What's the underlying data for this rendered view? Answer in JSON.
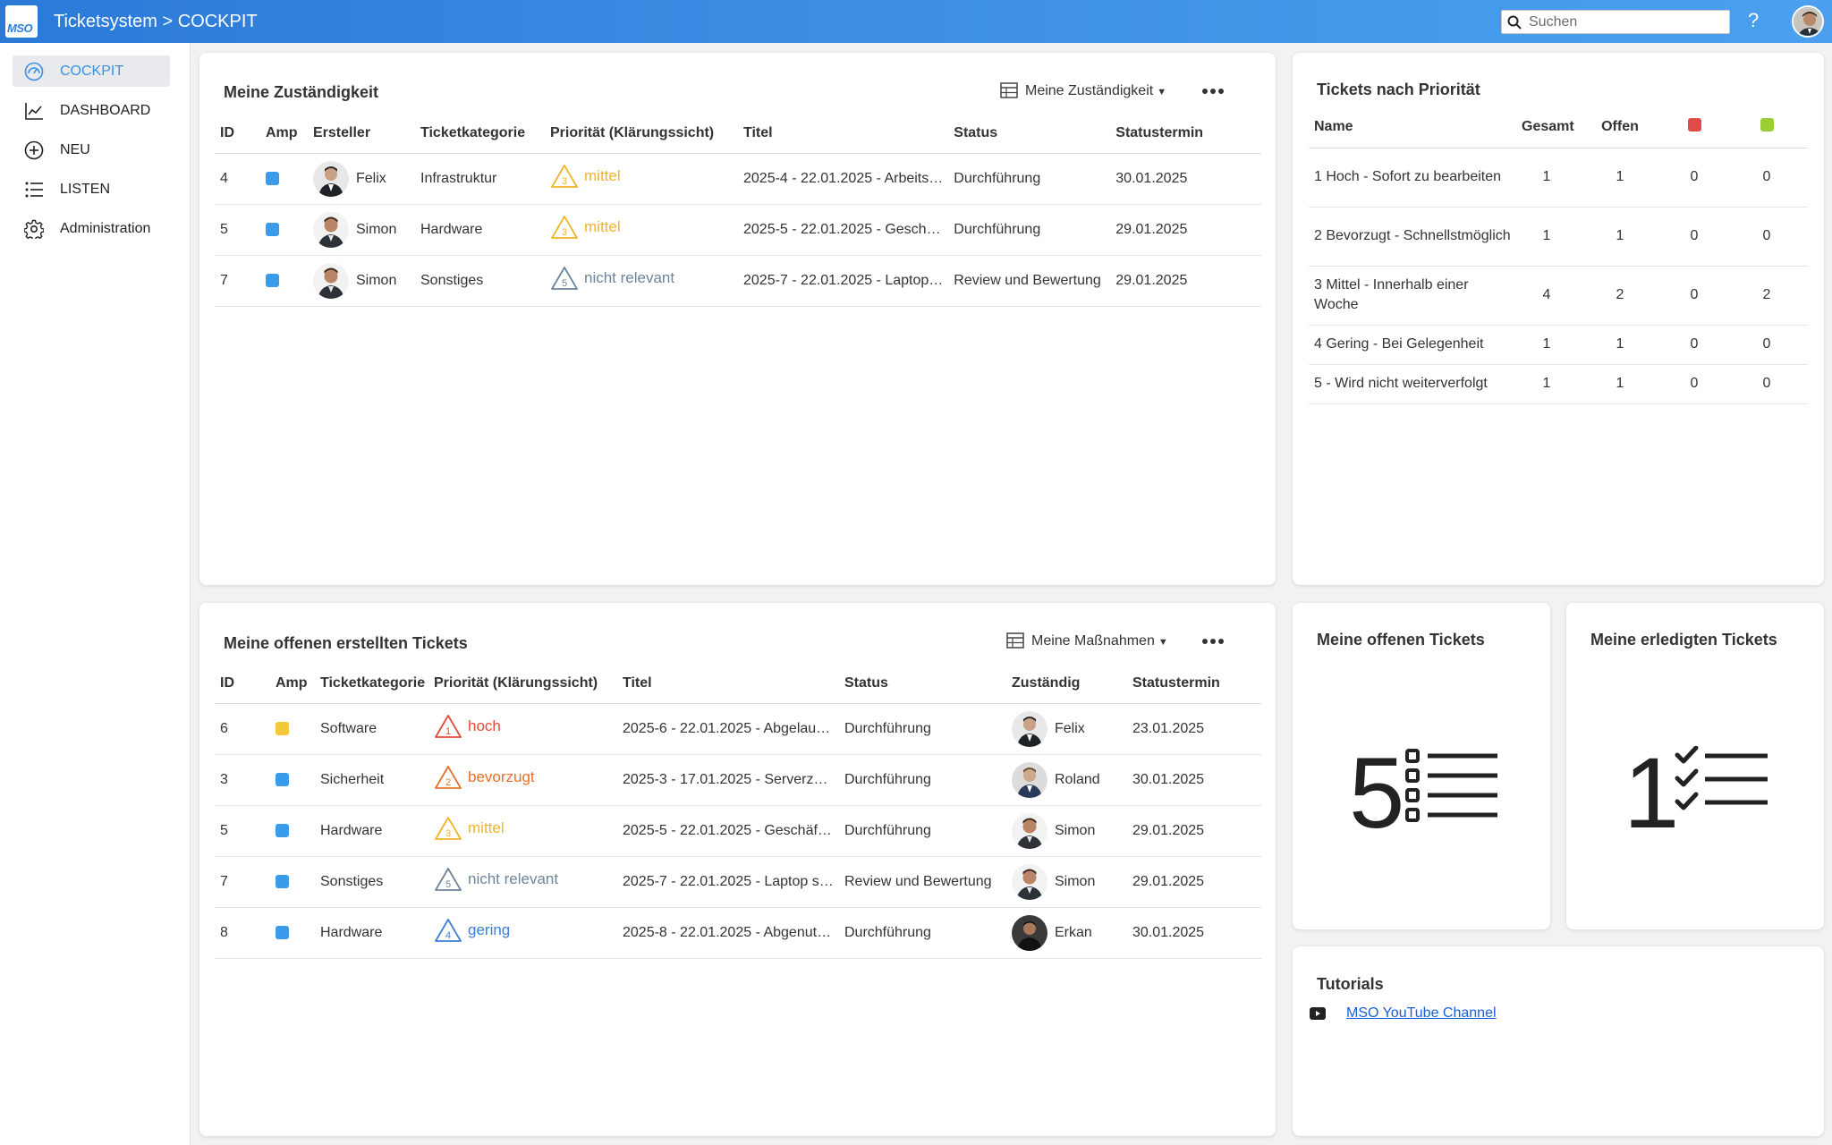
{
  "app": {
    "logo": "MSO",
    "title": "Ticketsystem > COCKPIT"
  },
  "search": {
    "placeholder": "Suchen"
  },
  "header": {
    "help": "?"
  },
  "sidebar": {
    "items": [
      {
        "label": "COCKPIT",
        "icon": "gauge-icon",
        "active": true
      },
      {
        "label": "DASHBOARD",
        "icon": "line-chart-icon"
      },
      {
        "label": "NEU",
        "icon": "plus-circle-icon"
      },
      {
        "label": "LISTEN",
        "icon": "list-icon"
      },
      {
        "label": "Administration",
        "icon": "gear-icon"
      }
    ]
  },
  "colors": {
    "accent": "#3d8fe0",
    "amp_blue": "#3a9bea",
    "amp_yellow": "#f2c93a",
    "prio_hoch": "#e24a3b",
    "prio_bevorzugt": "#e8702a",
    "prio_mittel": "#f0b429",
    "prio_nicht_relevant": "#6e8499",
    "prio_gering": "#3b7fd9",
    "flag_red": "#e04a4a",
    "flag_green": "#9acd32"
  },
  "panel1": {
    "title": "Meine Zuständigkeit",
    "view": "Meine Zuständigkeit",
    "columns": [
      "ID",
      "Amp",
      "Ersteller",
      "Ticketkategorie",
      "Priorität (Klärungssicht)",
      "Titel",
      "Status",
      "Statustermin"
    ],
    "rows": [
      {
        "id": "4",
        "amp": "blue",
        "creator": "Felix",
        "category": "Infrastruktur",
        "prio_num": "3",
        "prio": "mittel",
        "title": "2025-4 - 22.01.2025 - Arbeits…",
        "status": "Durchführung",
        "date": "30.01.2025"
      },
      {
        "id": "5",
        "amp": "blue",
        "creator": "Simon",
        "category": "Hardware",
        "prio_num": "3",
        "prio": "mittel",
        "title": "2025-5 - 22.01.2025 - Gesch…",
        "status": "Durchführung",
        "date": "29.01.2025"
      },
      {
        "id": "7",
        "amp": "blue",
        "creator": "Simon",
        "category": "Sonstiges",
        "prio_num": "5",
        "prio": "nicht relevant",
        "title": "2025-7 - 22.01.2025 - Laptop…",
        "status": "Review und Bewertung",
        "date": "29.01.2025"
      }
    ]
  },
  "panel2": {
    "title": "Meine offenen erstellten Tickets",
    "view": "Meine Maßnahmen",
    "columns": [
      "ID",
      "Amp",
      "Ticketkategorie",
      "Priorität (Klärungssicht)",
      "Titel",
      "Status",
      "Zuständig",
      "Statustermin"
    ],
    "rows": [
      {
        "id": "6",
        "amp": "yellow",
        "category": "Software",
        "prio_num": "1",
        "prio": "hoch",
        "title": "2025-6 - 22.01.2025 - Abgelauf…",
        "status": "Durchführung",
        "assignee": "Felix",
        "date": "23.01.2025"
      },
      {
        "id": "3",
        "amp": "blue",
        "category": "Sicherheit",
        "prio_num": "2",
        "prio": "bevorzugt",
        "title": "2025-3 - 17.01.2025 - Serverzer…",
        "status": "Durchführung",
        "assignee": "Roland",
        "date": "30.01.2025"
      },
      {
        "id": "5",
        "amp": "blue",
        "category": "Hardware",
        "prio_num": "3",
        "prio": "mittel",
        "title": "2025-5 - 22.01.2025 - Geschäft…",
        "status": "Durchführung",
        "assignee": "Simon",
        "date": "29.01.2025"
      },
      {
        "id": "7",
        "amp": "blue",
        "category": "Sonstiges",
        "prio_num": "5",
        "prio": "nicht relevant",
        "title": "2025-7 - 22.01.2025 - Laptop s…",
        "status": "Review und Bewertung",
        "assignee": "Simon",
        "date": "29.01.2025"
      },
      {
        "id": "8",
        "amp": "blue",
        "category": "Hardware",
        "prio_num": "4",
        "prio": "gering",
        "title": "2025-8 - 22.01.2025 - Abgenut…",
        "status": "Durchführung",
        "assignee": "Erkan",
        "date": "30.01.2025"
      }
    ]
  },
  "priority_panel": {
    "title": "Tickets nach Priorität",
    "columns": [
      "Name",
      "Gesamt",
      "Offen"
    ],
    "rows": [
      {
        "name": "1 Hoch - Sofort zu bearbeiten",
        "total": "1",
        "open": "1",
        "red": "0",
        "green": "0"
      },
      {
        "name": "2 Bevorzugt - Schnellstmöglich",
        "total": "1",
        "open": "1",
        "red": "0",
        "green": "0"
      },
      {
        "name": "3 Mittel - Innerhalb einer Woche",
        "total": "4",
        "open": "2",
        "red": "0",
        "green": "2"
      },
      {
        "name": "4 Gering - Bei Gelegenheit",
        "total": "1",
        "open": "1",
        "red": "0",
        "green": "0"
      },
      {
        "name": "5 - Wird nicht weiterverfolgt",
        "total": "1",
        "open": "1",
        "red": "0",
        "green": "0"
      }
    ]
  },
  "open_tickets": {
    "title": "Meine offenen Tickets",
    "count": "5"
  },
  "done_tickets": {
    "title": "Meine erledigten Tickets",
    "count": "1"
  },
  "tutorials": {
    "title": "Tutorials",
    "link": "MSO YouTube Channel"
  }
}
